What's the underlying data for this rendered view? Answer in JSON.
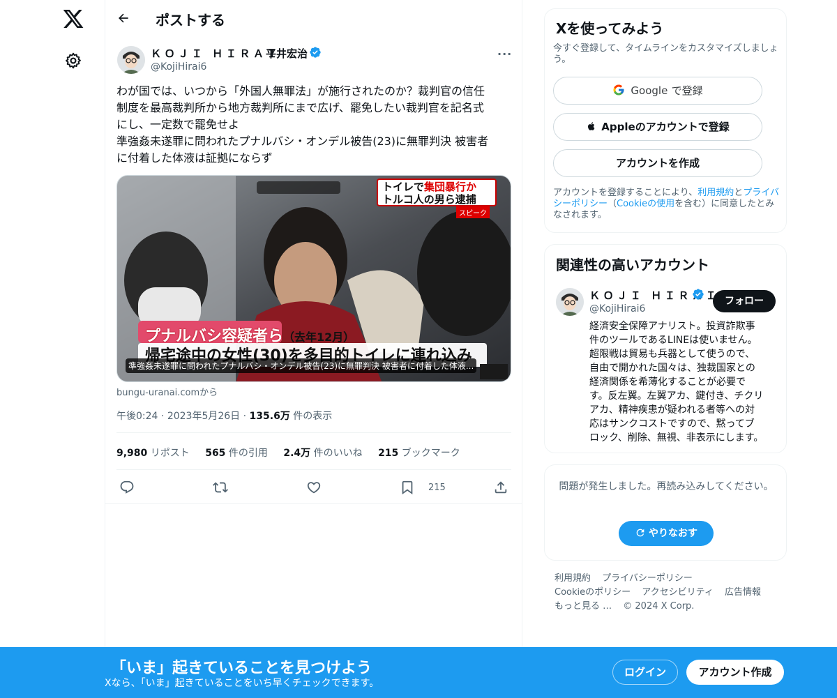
{
  "header": {
    "title": "ポストする"
  },
  "tweet": {
    "author_name": "ＫＯＪＩ ＨＩＲＡＩ",
    "author_name_jp": "平井宏治",
    "handle": "@KojiHirai6",
    "text_lines": [
      "わが国では、いつから「外国人無罪法」が施行されたのか？裁判官の信任",
      "制度を最高裁判所から地方裁判所にまで広げ、罷免したい裁判官を記名式",
      "にし、一定数で罷免せよ",
      "準強姦未遂罪に問われたプナルバシ・オンデル被告(23)に無罪判決 被害者",
      "に付着した体液は証拠にならず"
    ],
    "media": {
      "caption": "準強姦未遂罪に問われたプナルバシ・オンデル被告(23)に無罪判決 被害者に付着した体液...",
      "tv_box_line1_a": "トイレで",
      "tv_box_line1_b": "集団暴行か",
      "tv_box_line2": "トルコ人の男ら逮捕",
      "tv_box_sub": "スピーク",
      "tv_name": "プナルバシ容疑者ら",
      "tv_date": "（去年12月）",
      "tv_headline": "帰宅途中の女性(30)を多目的トイレに連れ込み"
    },
    "source": "bungu-uranai.comから",
    "time": "午後0:24",
    "date": "2023年5月26日",
    "views_num": "135.6万",
    "views_label": "件の表示",
    "stats": {
      "reposts_num": "9,980",
      "reposts_label": "リポスト",
      "quotes_num": "565",
      "quotes_label": "件の引用",
      "likes_num": "2.4万",
      "likes_label": "件のいいね",
      "bookmarks_num": "215",
      "bookmarks_label": "ブックマーク"
    },
    "bookmark_count": "215"
  },
  "signup_card": {
    "title": "Xを使ってみよう",
    "subtitle": "今すぐ登録して、タイムラインをカスタマイズしましょう。",
    "google_a": "Google",
    "google_b": "で登録",
    "apple": "Appleのアカウントで登録",
    "create": "アカウントを作成",
    "terms_1": "アカウントを登録することにより、",
    "terms_link1": "利用規約",
    "terms_2": "と",
    "terms_link2": "プライバシーポリシー",
    "terms_3": "（",
    "terms_link3": "Cookieの使用",
    "terms_4": "を含む）に同意したとみなされます。"
  },
  "relevant": {
    "title": "関連性の高いアカウント",
    "name": "ＫＯＪＩ ＨＩＲＡＩ",
    "handle": "@KojiHirai6",
    "follow": "フォロー",
    "bio_lines": [
      "経済安全保障アナリスト。投資詐欺事",
      "件のツールであるLINEは使いません。",
      "超限戦は貿易も兵器として使うので、",
      "自由で開かれた国々は、独裁国家との",
      "経済関係を希薄化することが必要で",
      "す。反左翼。左翼アカ、鍵付き、チクリ",
      "アカ、精神疾患が疑われる者等への対",
      "応はサンクコストですので、黙ってブ",
      "ロック、削除、無視、非表示にします。"
    ]
  },
  "error_card": {
    "message": "問題が発生しました。再読み込みしてください。",
    "retry": "やりなおす"
  },
  "footer": {
    "links": [
      "利用規約",
      "プライバシーポリシー",
      "Cookieのポリシー",
      "アクセシビリティ",
      "広告情報",
      "もっと見る …"
    ],
    "copyright": "© 2024 X Corp."
  },
  "banner": {
    "title": "「いま」起きていることを見つけよう",
    "subtitle": "Xなら、「いま」起きていることをいち早くチェックできます。",
    "login": "ログイン",
    "signup": "アカウント作成"
  },
  "colors": {
    "accent": "#1d9bf0",
    "text": "#0f1419",
    "muted": "#536471",
    "banner": "#1d9bf0"
  },
  "icons": [
    "x-logo-icon",
    "gear-icon",
    "back-arrow-icon",
    "verified-icon",
    "more-icon",
    "reply-icon",
    "repost-icon",
    "like-icon",
    "bookmark-icon",
    "share-icon",
    "google-icon",
    "apple-icon",
    "refresh-icon"
  ]
}
